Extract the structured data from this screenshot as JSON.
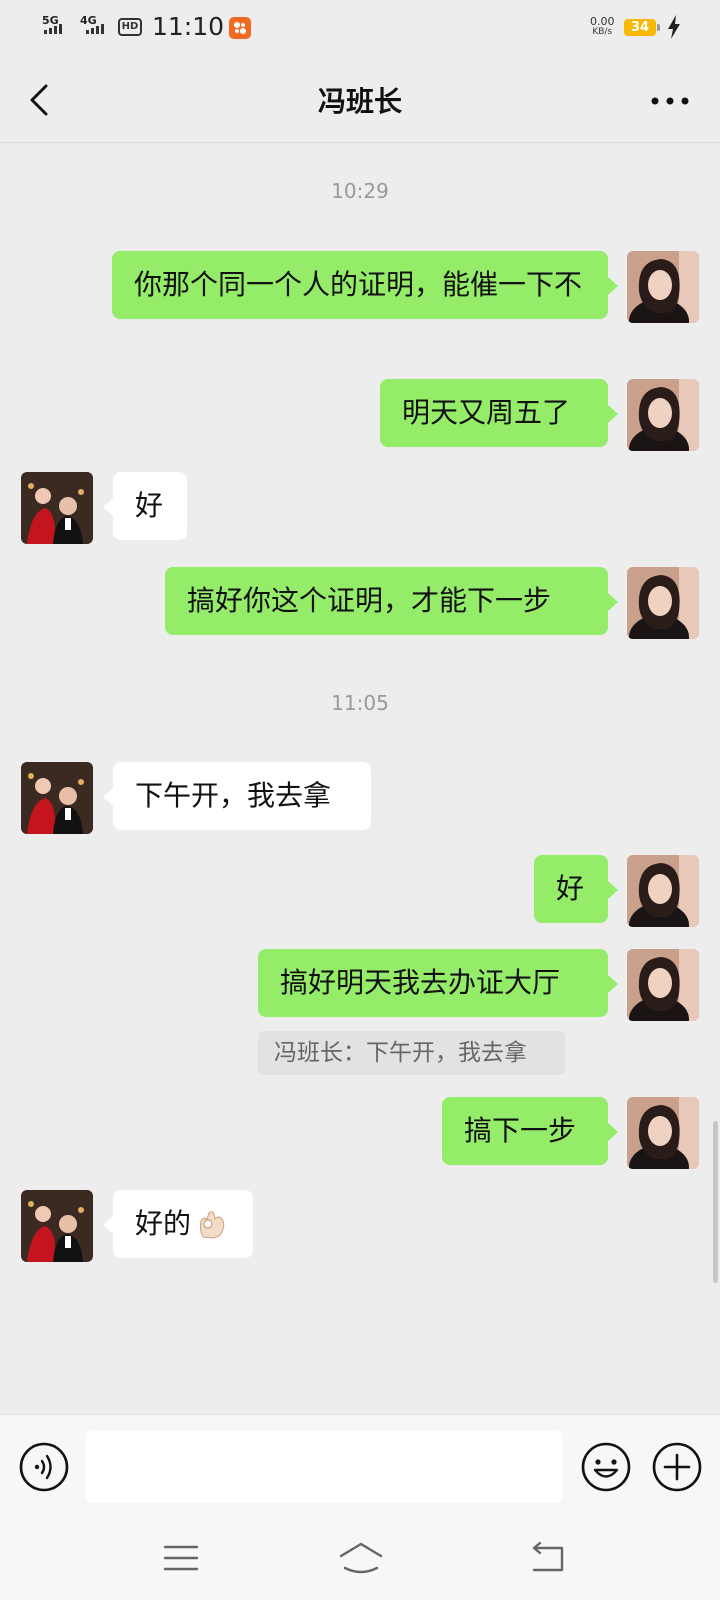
{
  "status_bar": {
    "network_1": "5G",
    "network_2": "4G",
    "hd_label": "HD",
    "time": "11:10",
    "app_badge": "",
    "speed_value": "0.00",
    "speed_unit": "KB/s",
    "battery": "34"
  },
  "header": {
    "title": "冯班长"
  },
  "messages": [
    {
      "kind": "time",
      "text": "10:29"
    },
    {
      "kind": "msg",
      "side": "me",
      "text": "你那个同一个人的证明，能催一下不"
    },
    {
      "kind": "msg",
      "side": "me",
      "text": "明天又周五了"
    },
    {
      "kind": "msg",
      "side": "other",
      "text": "好"
    },
    {
      "kind": "msg",
      "side": "me",
      "text": "搞好你这个证明，才能下一步"
    },
    {
      "kind": "time",
      "text": "11:05"
    },
    {
      "kind": "msg",
      "side": "other",
      "text": "下午开，我去拿"
    },
    {
      "kind": "msg",
      "side": "me",
      "text": "好"
    },
    {
      "kind": "msg",
      "side": "me",
      "text": "搞好明天我去办证大厅"
    },
    {
      "kind": "quote",
      "text": "冯班长：下午开，我去拿"
    },
    {
      "kind": "msg",
      "side": "me",
      "text": "搞下一步"
    },
    {
      "kind": "msg",
      "side": "other",
      "text": "好的",
      "emoji": "ok-hand"
    }
  ],
  "input": {
    "value": "",
    "placeholder": ""
  },
  "icons": {
    "back": "chevron-left-icon",
    "more": "more-dots-icon",
    "voice": "voice-icon",
    "emoji": "emoji-icon",
    "plus": "plus-icon",
    "menu": "menu-icon",
    "home": "home-icon",
    "return": "back-arrow-icon"
  },
  "colors": {
    "background": "#ededed",
    "my_bubble": "#95ec69",
    "their_bubble": "#ffffff",
    "timestamp": "#9a9a9a"
  }
}
